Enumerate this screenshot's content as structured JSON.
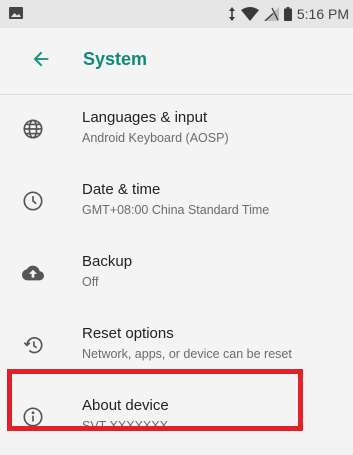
{
  "status_bar": {
    "time": "5:16 PM",
    "icons": [
      "image-icon",
      "data-arrows-icon",
      "wifi-icon",
      "signal-icon",
      "battery-icon"
    ]
  },
  "app_bar": {
    "title": "System",
    "back_icon": "arrow-left-icon"
  },
  "settings_items": [
    {
      "icon": "globe-icon",
      "title": "Languages & input",
      "subtitle": "Android Keyboard (AOSP)"
    },
    {
      "icon": "clock-icon",
      "title": "Date & time",
      "subtitle": "GMT+08:00 China Standard Time"
    },
    {
      "icon": "cloud-upload-icon",
      "title": "Backup",
      "subtitle": "Off"
    },
    {
      "icon": "restore-icon",
      "title": "Reset options",
      "subtitle": "Network, apps, or device can be reset"
    },
    {
      "icon": "info-icon",
      "title": "About device",
      "subtitle": "SVT XXXXXXX"
    }
  ],
  "colors": {
    "accent": "#0f8a78",
    "highlight": "#e0202a"
  }
}
